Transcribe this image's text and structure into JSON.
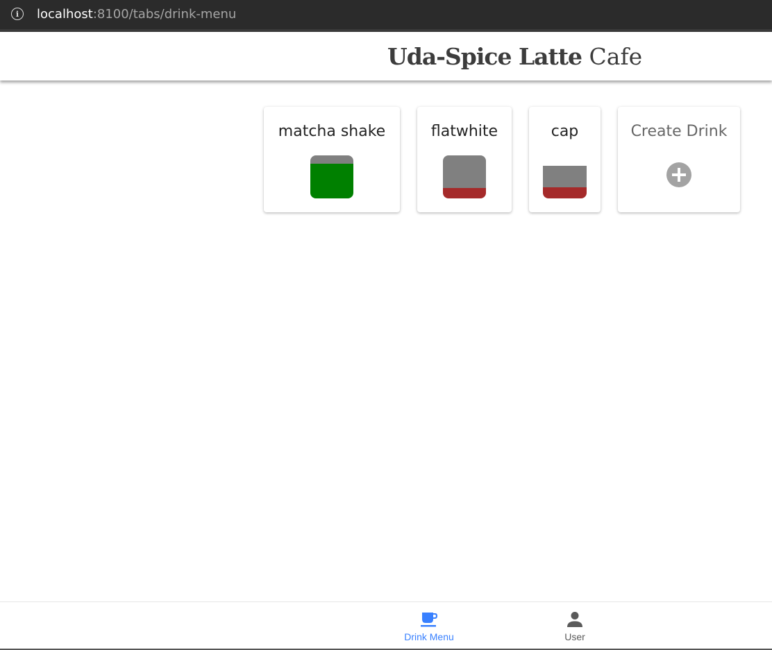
{
  "browser": {
    "url_host": "localhost",
    "url_rest": ":8100/tabs/drink-menu"
  },
  "header": {
    "title_bold": "Uda-Spice Latte",
    "title_light": "Cafe"
  },
  "drinks": [
    {
      "name": "matcha shake",
      "recipe": [
        {
          "color": "#808080",
          "parts": 1
        },
        {
          "color": "#008000",
          "parts": 4
        }
      ]
    },
    {
      "name": "flatwhite",
      "recipe": [
        {
          "color": "#808080",
          "parts": 3
        },
        {
          "color": "#a52a2a",
          "parts": 1
        }
      ]
    },
    {
      "name": "cap",
      "recipe": [
        {
          "color": "#808080",
          "parts": 2
        },
        {
          "color": "#a52a2a",
          "parts": 1
        }
      ]
    }
  ],
  "create_card": {
    "label": "Create Drink",
    "icon": "add-circle-icon"
  },
  "tabs": [
    {
      "label": "Drink Menu",
      "icon": "cafe-icon",
      "active": true
    },
    {
      "label": "User",
      "icon": "person-icon",
      "active": false
    }
  ],
  "colors": {
    "accent": "#3880ff",
    "tab_inactive": "#5a5a5a",
    "title_text": "#3c3c3c"
  }
}
